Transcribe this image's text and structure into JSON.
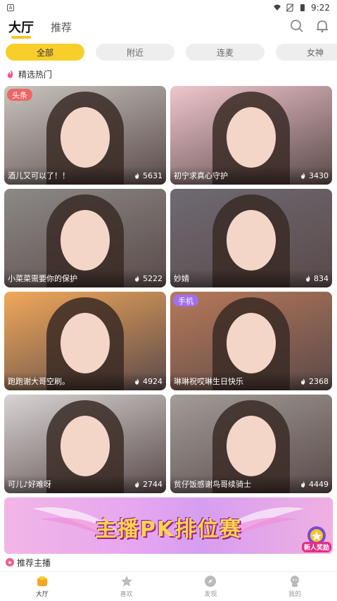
{
  "status_bar": {
    "time": "9:22",
    "notification_icon": "A"
  },
  "top_nav": {
    "tab_active": "大厅",
    "tab_other": "推荐"
  },
  "chips": [
    "全部",
    "附近",
    "连麦",
    "女神"
  ],
  "section_hot": {
    "title": "精选热门"
  },
  "cards": [
    {
      "title": "酒儿又可以了！！",
      "heat": "5631",
      "badge": "头条",
      "badge_color": "red",
      "bg": "#c9c4be"
    },
    {
      "title": "初宁求真心守护",
      "heat": "3430",
      "badge": "",
      "badge_color": "",
      "bg": "#f0c6cc"
    },
    {
      "title": "小菜菜需要你的保护",
      "heat": "5222",
      "badge": "",
      "badge_color": "",
      "bg": "#8c8a86"
    },
    {
      "title": "妙婧",
      "heat": "834",
      "badge": "",
      "badge_color": "",
      "bg": "#6e6a72"
    },
    {
      "title": "跑跑谢大哥空刷。",
      "heat": "4924",
      "badge": "",
      "badge_color": "",
      "bg": "#f2a85a"
    },
    {
      "title": "琳琳祝哎琳生日快乐",
      "heat": "2368",
      "badge": "手机",
      "badge_color": "purple",
      "bg": "#b87858"
    },
    {
      "title": "可儿♪好难呀",
      "heat": "2744",
      "badge": "",
      "badge_color": "",
      "bg": "#d8d4d4"
    },
    {
      "title": "贫仔饭感谢鸟哥续骑士",
      "heat": "4449",
      "badge": "",
      "badge_color": "",
      "bg": "#a29c98"
    }
  ],
  "banner": {
    "text": "主播PK排位赛",
    "reward_label": "新人奖励"
  },
  "section_rec": {
    "title": "推荐主播"
  },
  "bottom_nav": [
    {
      "label": "大厅",
      "icon": "home-icon",
      "active": true
    },
    {
      "label": "喜欢",
      "icon": "star-icon",
      "active": false
    },
    {
      "label": "发现",
      "icon": "compass-icon",
      "active": false
    },
    {
      "label": "我的",
      "icon": "profile-icon",
      "active": false
    }
  ],
  "colors": {
    "accent": "#f8ce2a",
    "hot": "#f05a8a",
    "badge_red": "#f06464",
    "badge_purple": "#a070ee"
  }
}
